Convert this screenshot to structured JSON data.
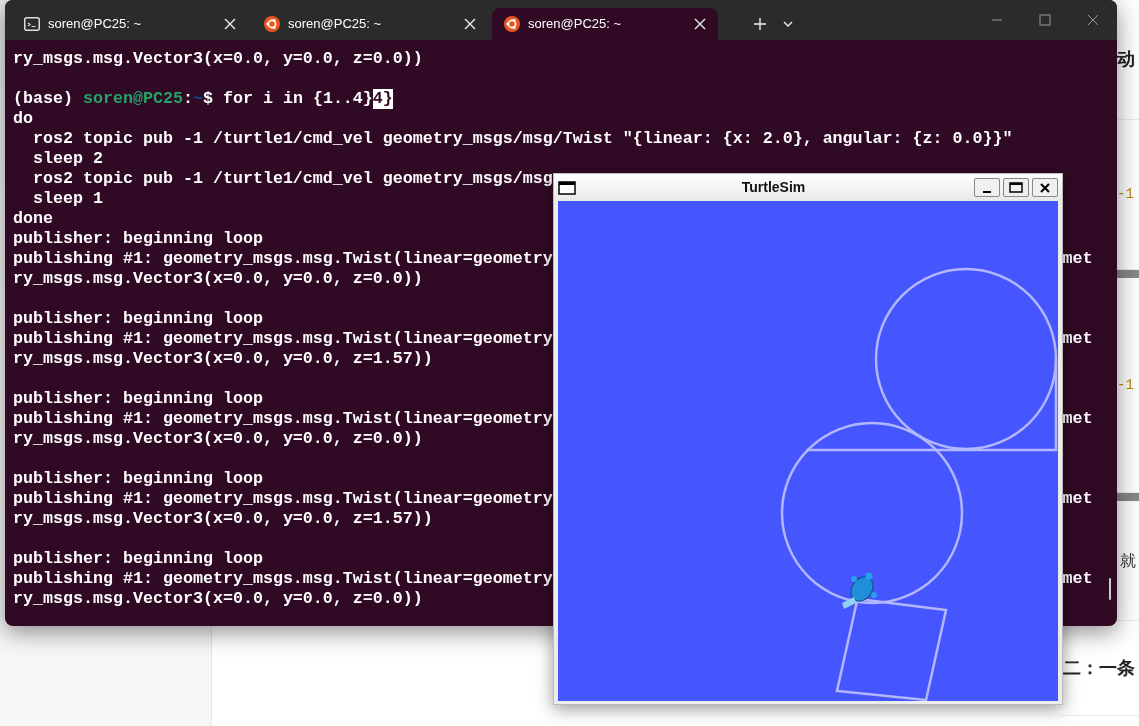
{
  "background_page": {
    "items": [
      {
        "kind": "heading",
        "text": "动"
      },
      {
        "kind": "code",
        "text": "-1"
      },
      {
        "kind": "code",
        "text": "-1"
      },
      {
        "kind": "text",
        "text": "就"
      },
      {
        "kind": "heading",
        "text": "二：一条"
      }
    ]
  },
  "terminal": {
    "tabs": [
      {
        "kind": "cmd",
        "label": "soren@PC25: ~",
        "selected": false
      },
      {
        "kind": "ubuntu",
        "label": "soren@PC25: ~",
        "selected": false
      },
      {
        "kind": "ubuntu",
        "label": "soren@PC25: ~",
        "selected": true
      }
    ],
    "lines": [
      {
        "kind": "output",
        "text": "ry_msgs.msg.Vector3(x=0.0, y=0.0, z=0.0))"
      },
      {
        "kind": "blank"
      },
      {
        "kind": "prompt",
        "env": "(base)",
        "user_host": "soren@PC25",
        "colon": ":",
        "path": "~",
        "dollar": "$",
        "command": "for i in {1..4}",
        "cursor": "4}"
      },
      {
        "kind": "output",
        "text": "do"
      },
      {
        "kind": "output",
        "text": "  ros2 topic pub -1 /turtle1/cmd_vel geometry_msgs/msg/Twist \"{linear: {x: 2.0}, angular: {z: 0.0}}\""
      },
      {
        "kind": "output",
        "text": "  sleep 2"
      },
      {
        "kind": "output",
        "text": "  ros2 topic pub -1 /turtle1/cmd_vel geometry_msgs/msg"
      },
      {
        "kind": "output",
        "text": "  sleep 1"
      },
      {
        "kind": "output",
        "text": "done"
      },
      {
        "kind": "output",
        "text": "publisher: beginning loop"
      },
      {
        "kind": "output",
        "text": "publishing #1: geometry_msgs.msg.Twist(linear=geometry",
        "tail": "met"
      },
      {
        "kind": "output",
        "text": "ry_msgs.msg.Vector3(x=0.0, y=0.0, z=0.0))"
      },
      {
        "kind": "blank"
      },
      {
        "kind": "output",
        "text": "publisher: beginning loop"
      },
      {
        "kind": "output",
        "text": "publishing #1: geometry_msgs.msg.Twist(linear=geometry",
        "tail": "met"
      },
      {
        "kind": "output",
        "text": "ry_msgs.msg.Vector3(x=0.0, y=0.0, z=1.57))"
      },
      {
        "kind": "blank"
      },
      {
        "kind": "output",
        "text": "publisher: beginning loop"
      },
      {
        "kind": "output",
        "text": "publishing #1: geometry_msgs.msg.Twist(linear=geometry",
        "tail": "met"
      },
      {
        "kind": "output",
        "text": "ry_msgs.msg.Vector3(x=0.0, y=0.0, z=0.0))"
      },
      {
        "kind": "blank"
      },
      {
        "kind": "output",
        "text": "publisher: beginning loop"
      },
      {
        "kind": "output",
        "text": "publishing #1: geometry_msgs.msg.Twist(linear=geometry",
        "tail": "met"
      },
      {
        "kind": "output",
        "text": "ry_msgs.msg.Vector3(x=0.0, y=0.0, z=1.57))"
      },
      {
        "kind": "blank"
      },
      {
        "kind": "output",
        "text": "publisher: beginning loop"
      },
      {
        "kind": "output",
        "text": "publishing #1: geometry_msgs.msg.Twist(linear=geometry",
        "tail": "met"
      },
      {
        "kind": "output",
        "text": "ry_msgs.msg.Vector3(x=0.0, y=0.0, z=0.0))"
      }
    ]
  },
  "turtlesim": {
    "title": "TurtleSim"
  }
}
